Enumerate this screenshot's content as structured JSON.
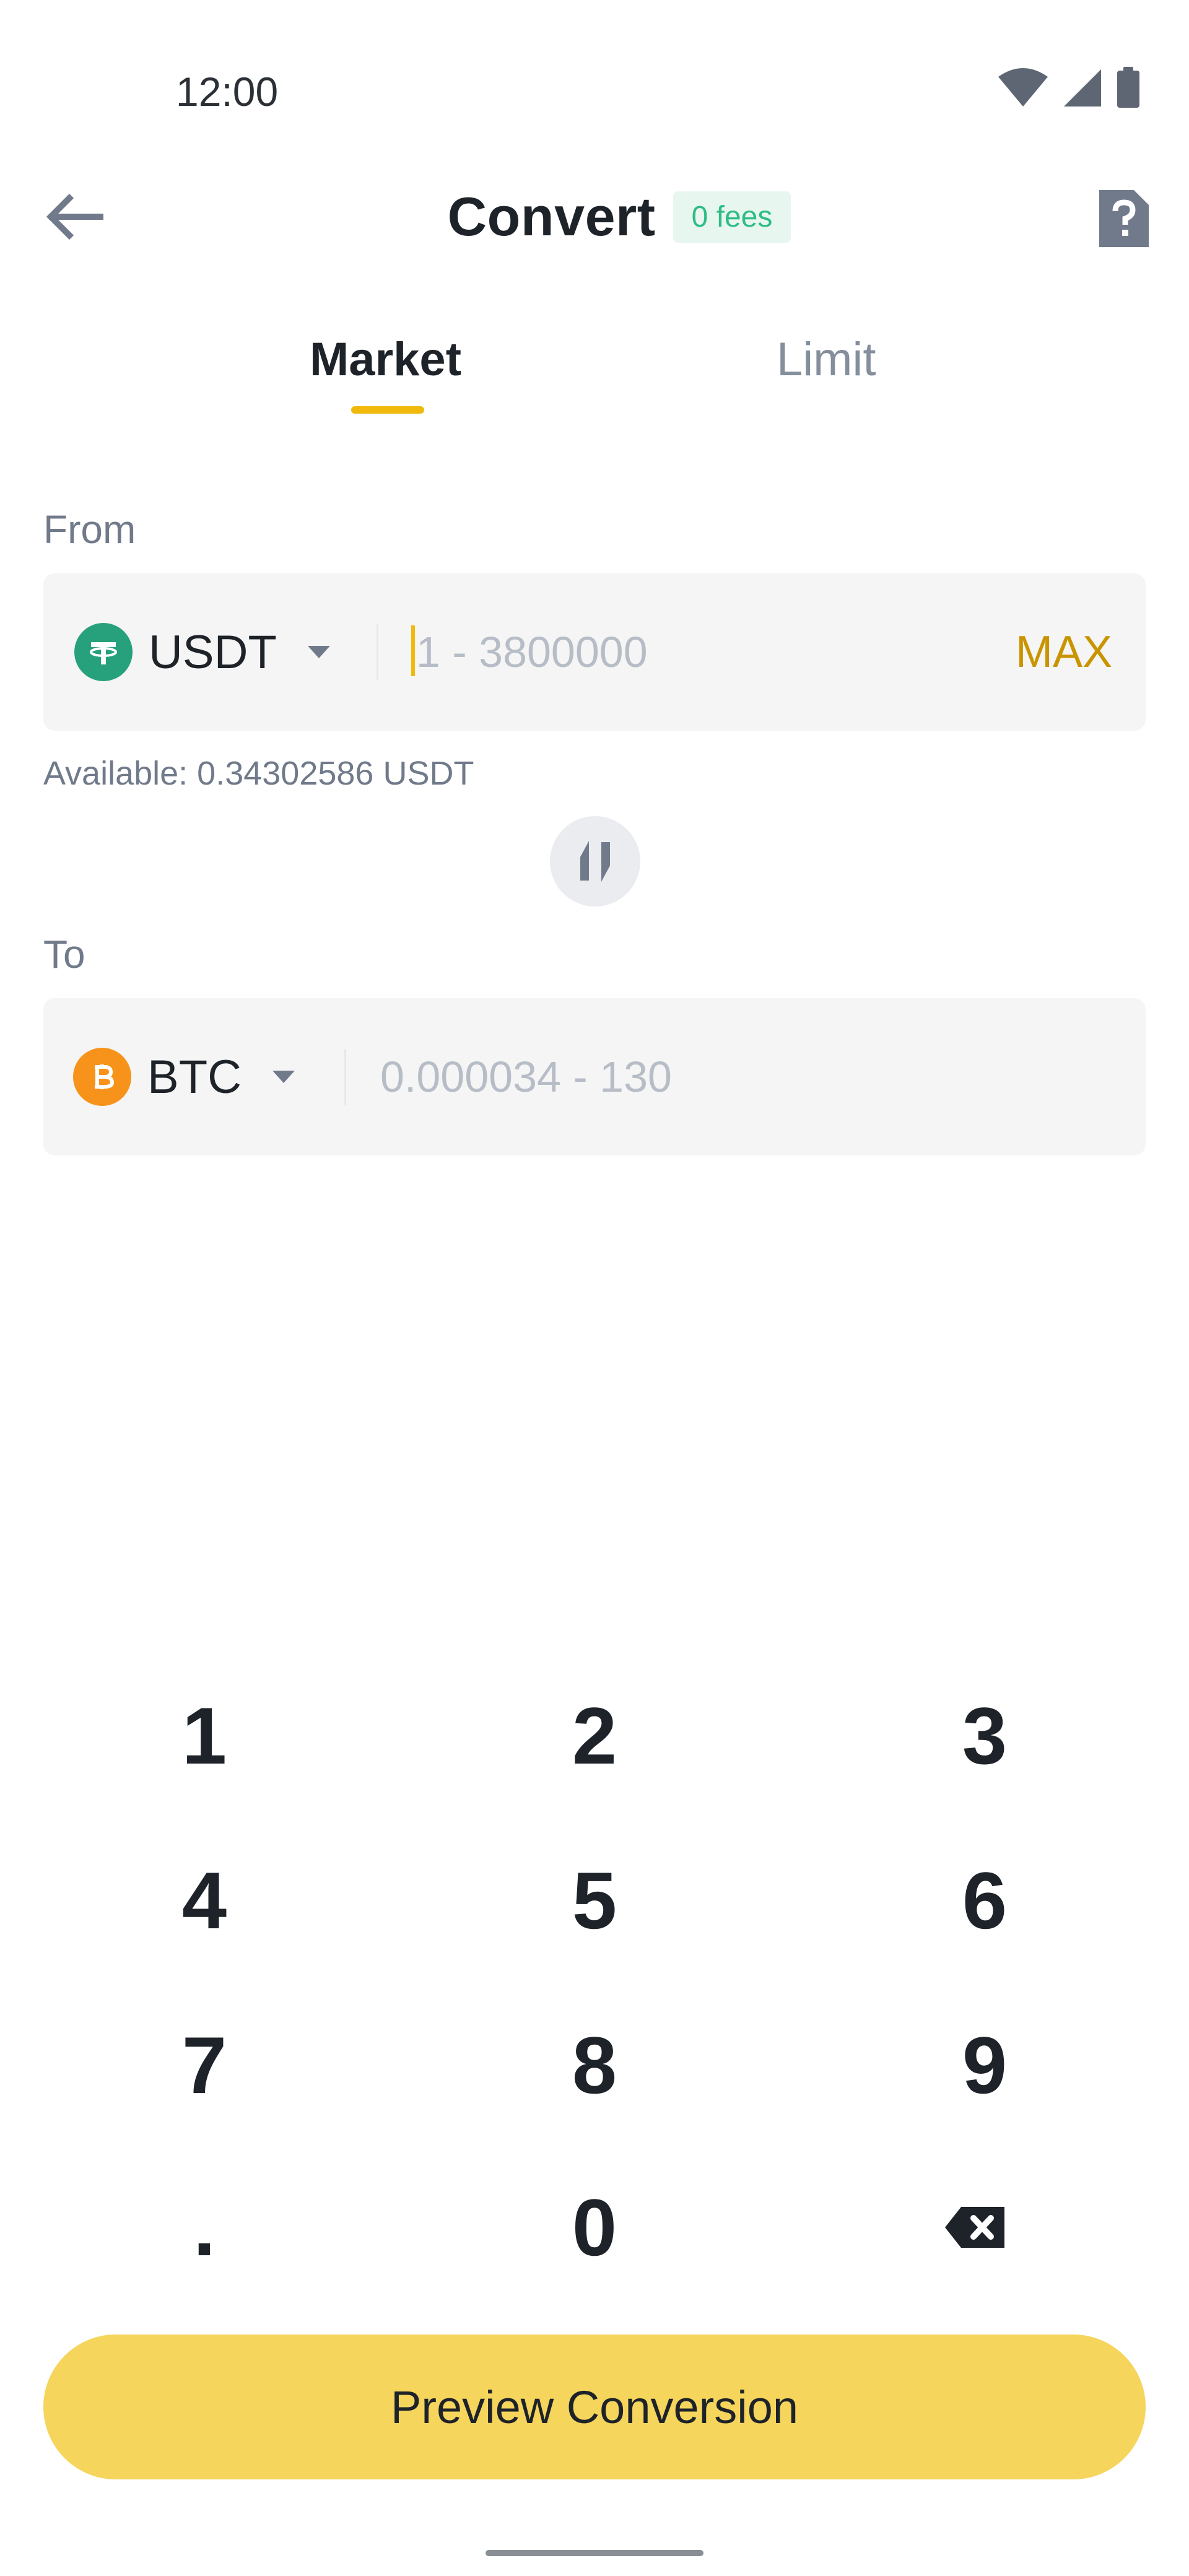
{
  "status_bar": {
    "time": "12:00",
    "icons": [
      "wifi-icon",
      "cellular-signal-icon",
      "battery-icon"
    ]
  },
  "header": {
    "title": "Convert",
    "badge": "0 fees",
    "back_icon": "arrow-left-icon",
    "help_icon": "help-document-icon"
  },
  "tabs": [
    {
      "label": "Market",
      "active": true
    },
    {
      "label": "Limit",
      "active": false
    }
  ],
  "from": {
    "label": "From",
    "asset": "USDT",
    "asset_icon": "tether-icon",
    "placeholder": "1 - 3800000",
    "value": "",
    "max_label": "MAX",
    "available": "Available: 0.34302586 USDT"
  },
  "swap": {
    "icon": "swap-vertical-icon"
  },
  "to": {
    "label": "To",
    "asset": "BTC",
    "asset_icon": "bitcoin-icon",
    "placeholder": "0.000034 - 130",
    "value": ""
  },
  "keypad": {
    "keys": [
      "1",
      "2",
      "3",
      "4",
      "5",
      "6",
      "7",
      "8",
      "9",
      ".",
      "0"
    ],
    "backspace_icon": "backspace-icon"
  },
  "preview_button": {
    "label": "Preview Conversion"
  },
  "colors": {
    "accent": "#f0b90b",
    "button": "#f6d55c",
    "fees_text": "#2ebd85",
    "fees_bg": "#e8f6f0",
    "max_text": "#c99400",
    "tether": "#26a17b",
    "bitcoin": "#f7931a"
  }
}
